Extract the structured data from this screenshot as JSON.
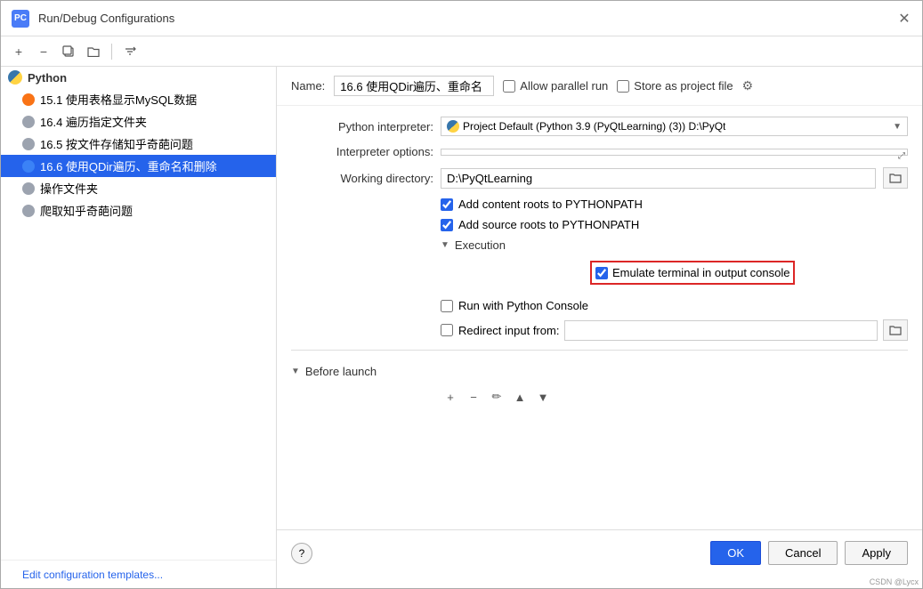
{
  "dialog": {
    "title": "Run/Debug Configurations",
    "icon_label": "PC"
  },
  "toolbar": {
    "add_label": "+",
    "remove_label": "−",
    "copy_label": "⧉",
    "folder_label": "📁",
    "sort_label": "↕"
  },
  "sidebar": {
    "section_label": "Python",
    "items": [
      {
        "label": "15.1 使用表格显示MySQL数据",
        "icon": "orange",
        "selected": false
      },
      {
        "label": "16.4 遍历指定文件夹",
        "icon": "gray",
        "selected": false
      },
      {
        "label": "16.5 按文件存储知乎奇葩问题",
        "icon": "gray",
        "selected": false
      },
      {
        "label": "16.6 使用QDir遍历、重命名和删除",
        "icon": "blue",
        "selected": true
      },
      {
        "label": "操作文件夹",
        "icon": "gray",
        "selected": false
      },
      {
        "label": "爬取知乎奇葩问题",
        "icon": "gray",
        "selected": false
      }
    ],
    "edit_templates_label": "Edit configuration templates..."
  },
  "config": {
    "name_label": "Name:",
    "name_value": "16.6 使用QDir遍历、重命名",
    "allow_parallel_label": "Allow parallel run",
    "store_as_project_label": "Store as project file",
    "python_interpreter_label": "Python interpreter:",
    "interpreter_value": "Project Default (Python 3.9 (PyQtLearning) (3)) D:\\PyQt",
    "interpreter_options_label": "Interpreter options:",
    "interpreter_options_value": "",
    "working_directory_label": "Working directory:",
    "working_directory_value": "D:\\PyQtLearning",
    "add_content_roots_label": "Add content roots to PYTHONPATH",
    "add_source_roots_label": "Add source roots to PYTHONPATH",
    "execution_label": "Execution",
    "emulate_terminal_label": "Emulate terminal in output console",
    "run_python_console_label": "Run with Python Console",
    "redirect_input_label": "Redirect input from:",
    "redirect_input_value": "",
    "before_launch_label": "Before launch"
  },
  "footer": {
    "ok_label": "OK",
    "cancel_label": "Cancel",
    "apply_label": "Apply",
    "help_label": "?"
  },
  "credits": "CSDN @Lycx"
}
